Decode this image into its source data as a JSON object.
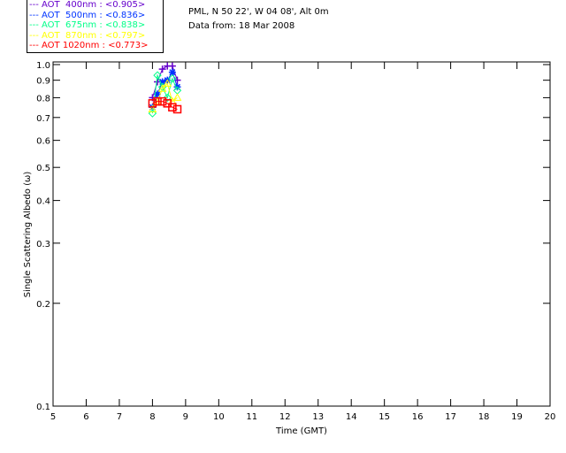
{
  "chart_data": {
    "type": "line",
    "xlabel": "Time (GMT)",
    "ylabel": "Single Scattering Albedo (ω)",
    "xlim": [
      5,
      20
    ],
    "ylim": [
      0.1,
      1.0
    ],
    "yscale": "log",
    "xticks": [
      5,
      6,
      7,
      8,
      9,
      10,
      11,
      12,
      13,
      14,
      15,
      16,
      17,
      18,
      19,
      20
    ],
    "yticks": [
      0.1,
      0.2,
      0.3,
      0.4,
      0.5,
      0.6,
      0.7,
      0.8,
      0.9,
      1.0
    ],
    "ytick_labels": [
      "0.1",
      "0.2",
      "0.3",
      "0.4",
      "0.5",
      "0.6",
      "0.7",
      "0.8",
      "0.9",
      "1.0"
    ],
    "x": [
      8.0,
      8.15,
      8.3,
      8.45,
      8.6,
      8.75
    ],
    "series": [
      {
        "name": "AOT  400nm : <0.905>",
        "color": "#6600cc",
        "marker": "plus",
        "values": [
          0.8,
          0.89,
          0.97,
          0.99,
          0.99,
          0.9
        ]
      },
      {
        "name": "AOT  500nm : <0.836>",
        "color": "#0033ff",
        "marker": "asterisk",
        "values": [
          0.75,
          0.82,
          0.89,
          0.9,
          0.95,
          0.86
        ]
      },
      {
        "name": "AOT  675nm : <0.838>",
        "color": "#00ff88",
        "marker": "diamond",
        "values": [
          0.72,
          0.93,
          0.86,
          0.8,
          0.91,
          0.84
        ]
      },
      {
        "name": "AOT  870nm : <0.797>",
        "color": "#ffff00",
        "marker": "triangle",
        "values": [
          0.74,
          0.78,
          0.85,
          0.88,
          0.78,
          0.8
        ]
      },
      {
        "name": "AOT 1020nm : <0.773>",
        "color": "#ff0000",
        "marker": "square",
        "values": [
          0.77,
          0.78,
          0.78,
          0.77,
          0.75,
          0.74
        ]
      }
    ]
  },
  "info": {
    "location": "PML, N 50 22', W 04 08', Alt 0m",
    "date": "Data from: 18 Mar 2008"
  },
  "legend_prefix": "---"
}
